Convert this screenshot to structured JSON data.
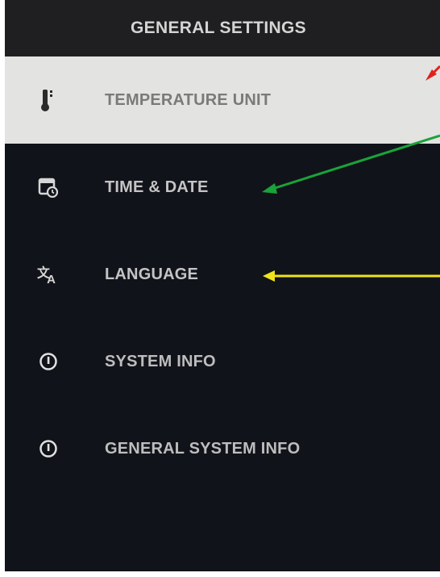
{
  "header": {
    "title": "GENERAL SETTINGS"
  },
  "menu": {
    "items": [
      {
        "label": "TEMPERATURE UNIT",
        "icon": "thermometer-icon",
        "selected": true
      },
      {
        "label": "TIME & DATE",
        "icon": "calendar-clock-icon",
        "selected": false
      },
      {
        "label": "LANGUAGE",
        "icon": "translate-icon",
        "selected": false
      },
      {
        "label": "SYSTEM INFO",
        "icon": "info-icon",
        "selected": false
      },
      {
        "label": "GENERAL SYSTEM INFO",
        "icon": "info-icon",
        "selected": false
      }
    ]
  },
  "annotation_arrows": [
    {
      "name": "red-arrow",
      "color": "#e0231c"
    },
    {
      "name": "green-arrow",
      "color": "#19a33a"
    },
    {
      "name": "yellow-arrow",
      "color": "#f2e21a"
    }
  ]
}
